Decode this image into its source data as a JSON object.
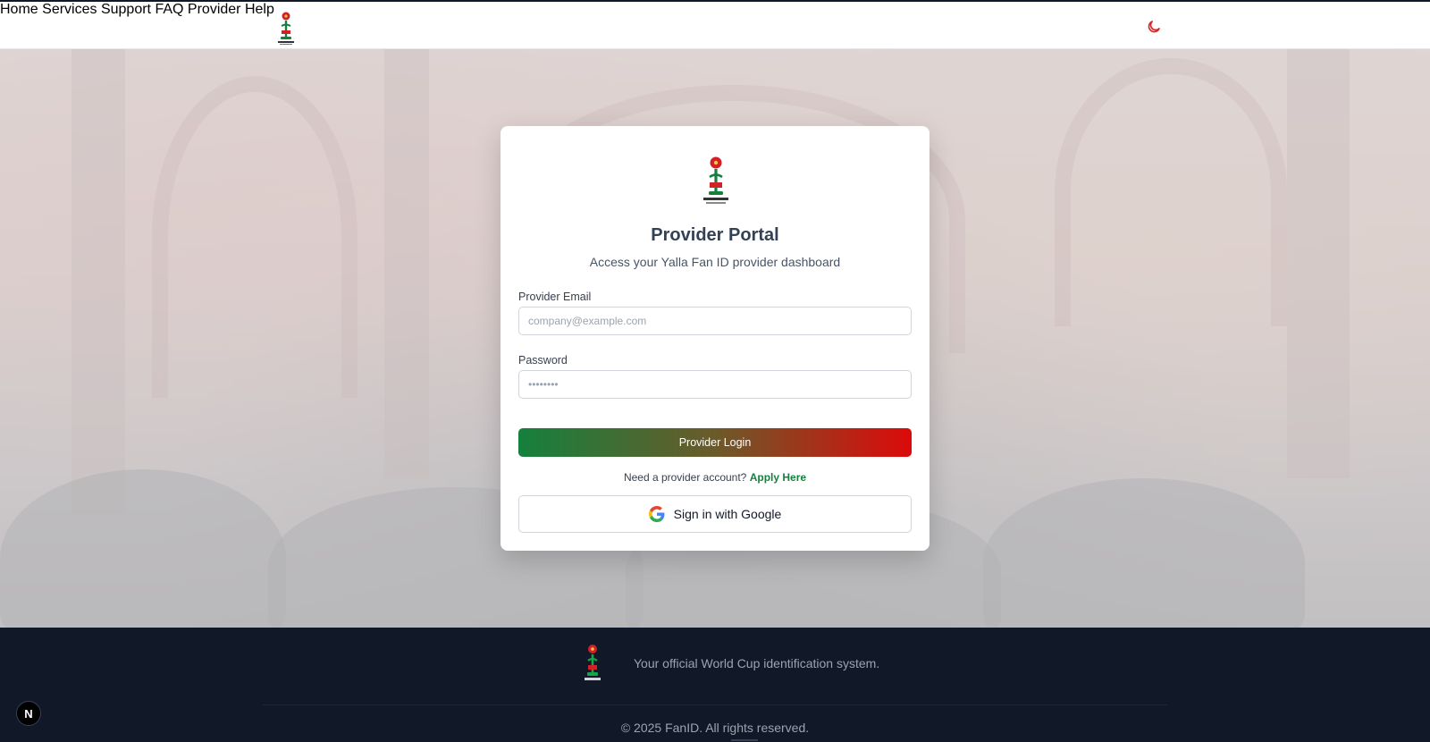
{
  "nav": {
    "items": [
      {
        "label": "Home"
      },
      {
        "label": "Services"
      },
      {
        "label": "Support"
      },
      {
        "label": "FAQ"
      },
      {
        "label": "Provider Help"
      }
    ],
    "theme_icon": "moon-icon"
  },
  "card": {
    "title": "Provider Portal",
    "subtitle": "Access your Yalla Fan ID provider dashboard",
    "email_label": "Provider Email",
    "email_placeholder": "company@example.com",
    "email_value": "",
    "password_label": "Password",
    "password_placeholder": "••••••••",
    "password_value": "",
    "login_label": "Provider Login",
    "account_prompt": "Need a provider account?",
    "apply_label": "Apply Here",
    "google_label": "Sign in with Google"
  },
  "footer": {
    "tagline": "Your official World Cup identification system.",
    "copyright": "© 2025 FanID. All rights reserved."
  },
  "badge": {
    "label": "N"
  },
  "colors": {
    "accent_green": "#15803d",
    "accent_red": "#dc0a0a",
    "footer_bg": "#111827"
  }
}
